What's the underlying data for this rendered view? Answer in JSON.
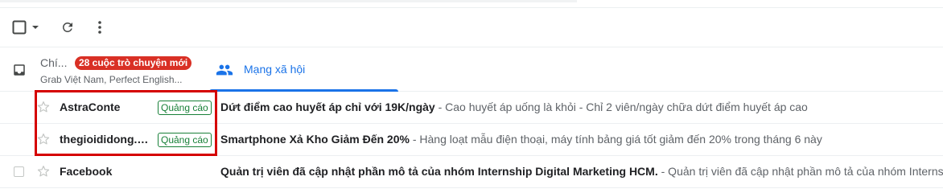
{
  "toolbar": {
    "select_icon": "checkbox-icon",
    "dropdown_icon": "chevron-down-icon",
    "refresh_icon": "refresh-icon",
    "more_icon": "more-vert-icon"
  },
  "tabs": [
    {
      "label": "Chí...",
      "badge": "28 cuộc trò chuyện mới",
      "subtitle": "Grab Việt Nam, Perfect English...",
      "icon": "inbox-icon",
      "active": false
    },
    {
      "label": "Mạng xã hội",
      "icon": "people-icon",
      "active": true
    }
  ],
  "emails": [
    {
      "sender": "AstraConte",
      "ad": "Quảng cáo",
      "subject": "Dứt điểm cao huyết áp chỉ với 19K/ngày",
      "snippet": " - Cao huyết áp uống là khỏi - Chỉ 2 viên/ngày chữa dứt điểm huyết áp cao"
    },
    {
      "sender": "thegioididong.c...",
      "ad": "Quảng cáo",
      "subject": "Smartphone Xả Kho Giảm Đến 20%",
      "snippet": " - Hàng loạt mẫu điện thoại, máy tính bảng giá tốt giảm đến 20% trong tháng 6 này"
    },
    {
      "sender": "Facebook",
      "ad": "",
      "subject": "Quản trị viên đã cập nhật phần mô tả của nhóm Internship Digital Marketing HCM.",
      "snippet": " - Quản trị viên đã cập nhật phần mô tả của nhóm Internship Digital Marketing HCM"
    }
  ],
  "colors": {
    "accent": "#1a73e8",
    "badge": "#d93025",
    "ad_label": "#188038",
    "highlight": "#d50000"
  }
}
